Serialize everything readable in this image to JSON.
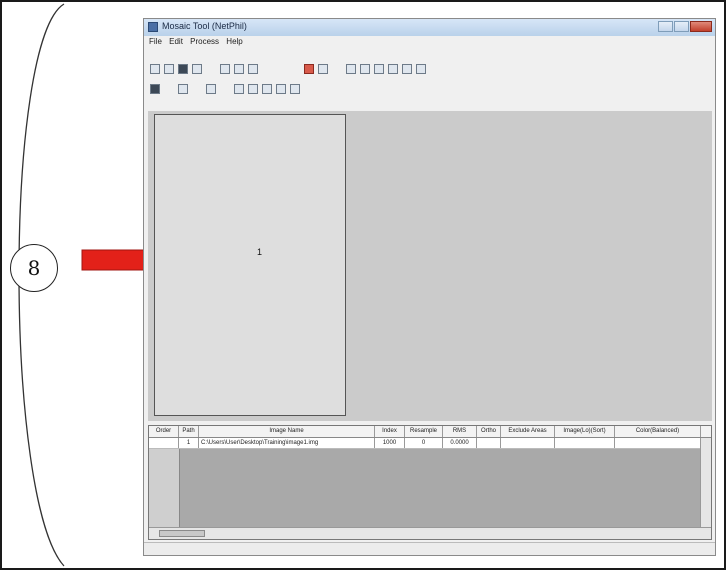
{
  "step_marker": "8",
  "app": {
    "title": "Mosaic Tool (NetPhil)",
    "menu": [
      "File",
      "Edit",
      "Process",
      "Help"
    ]
  },
  "canvas": {
    "tile_number": "1"
  },
  "grid": {
    "columns": [
      "Order",
      "Path",
      "Image Name",
      "Index",
      "Resample",
      "RMS",
      "Ortho",
      "Exclude Areas",
      "Image(Lo)(Sort)",
      "Color(Balanced)"
    ],
    "rows": [
      [
        "",
        "1",
        "C:\\Users\\User\\Desktop\\Training\\image1.img",
        "1000",
        "0",
        "0.0000",
        "",
        "",
        "",
        ""
      ]
    ]
  },
  "colors": {
    "arrow": "#e32119",
    "title_bar": "#c9dcf1"
  }
}
